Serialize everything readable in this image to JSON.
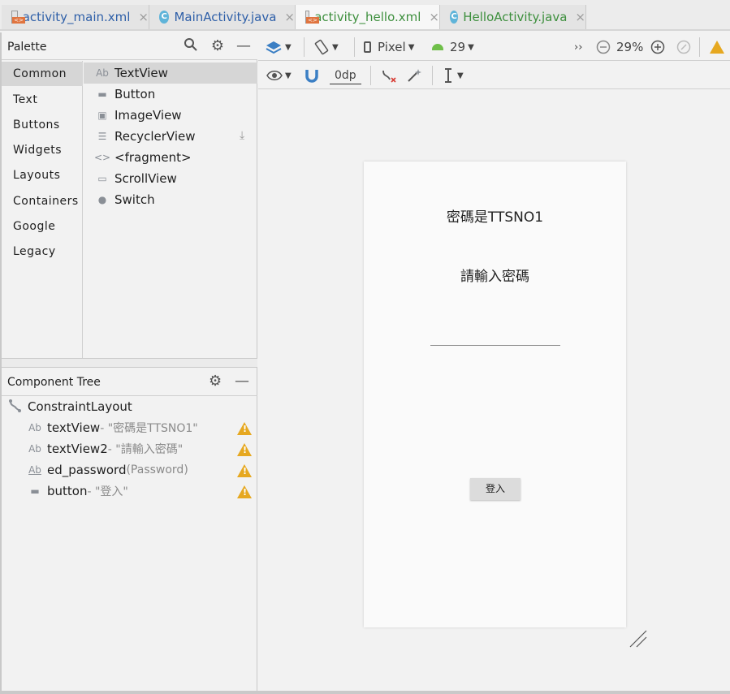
{
  "tabs": [
    {
      "label": "activity_main.xml",
      "type": "xml",
      "color": "blue"
    },
    {
      "label": "MainActivity.java",
      "type": "class",
      "color": "blue"
    },
    {
      "label": "activity_hello.xml",
      "type": "xml",
      "color": "green"
    },
    {
      "label": "HelloActivity.java",
      "type": "class",
      "color": "green"
    }
  ],
  "palette": {
    "title": "Palette",
    "categories": [
      "Common",
      "Text",
      "Buttons",
      "Widgets",
      "Layouts",
      "Containers",
      "Google",
      "Legacy"
    ],
    "items": [
      "TextView",
      "Button",
      "ImageView",
      "RecyclerView",
      "<fragment>",
      "ScrollView",
      "Switch"
    ],
    "item_icons": [
      "Ab",
      "▬",
      "▣",
      "☰",
      "<>",
      "▭",
      "●"
    ]
  },
  "tree": {
    "title": "Component Tree",
    "root": "ConstraintLayout",
    "nodes": [
      {
        "id": "textView",
        "detail": "- \"密碼是TTSNO1\"",
        "icon": "Ab"
      },
      {
        "id": "textView2",
        "detail": "- \"請輸入密碼\"",
        "icon": "Ab"
      },
      {
        "id": "ed_password",
        "detail": "(Password)",
        "icon": "Ab"
      },
      {
        "id": "button",
        "detail": "- \"登入\"",
        "icon": "▬"
      }
    ]
  },
  "toolbar": {
    "device": "Pixel",
    "api": "29",
    "zoom": "29%",
    "margin": "0dp",
    "overflow": "››"
  },
  "preview": {
    "text1": "密碼是TTSNO1",
    "text2": "請輸入密碼",
    "button": "登入"
  },
  "colors": {
    "warning": "#e6a820",
    "blue_tab": "#2e5fa8",
    "green_tab": "#3d8f3d"
  }
}
